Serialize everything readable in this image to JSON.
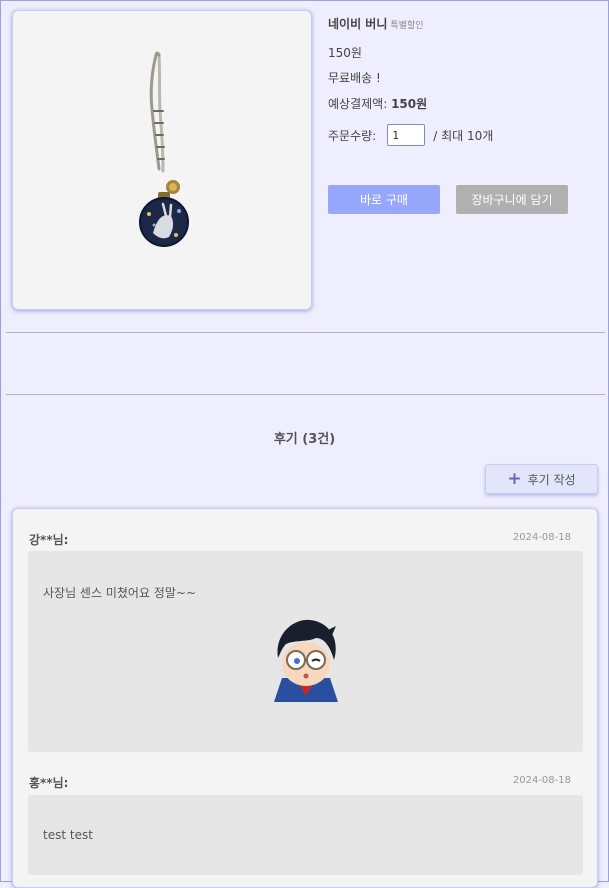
{
  "product": {
    "name": "네이비 버니",
    "badge": "특별할인",
    "price": "150원",
    "shipping": "무료배송 !",
    "expected_label": "예상결제액: ",
    "expected_value": "150원",
    "quantity_label": "주문수량:",
    "quantity_value": "1",
    "quantity_max": "/ 최대 10개",
    "buy_label": "바로 구매",
    "cart_label": "장바구니에 담기"
  },
  "reviews": {
    "title": "후기 (3건)",
    "write_label": "후기 작성",
    "items": [
      {
        "author": "강**님:",
        "date": "2024-08-18",
        "text": "사장님 센스 미쳤어요 정말~~"
      },
      {
        "author": "홍**님:",
        "date": "2024-08-18",
        "text": "test test"
      }
    ]
  },
  "colors": {
    "primary": "#97a7fb",
    "secondary": "#b0b0b0",
    "page_bg": "#eeeefe",
    "accent": "#6b5fb8"
  }
}
